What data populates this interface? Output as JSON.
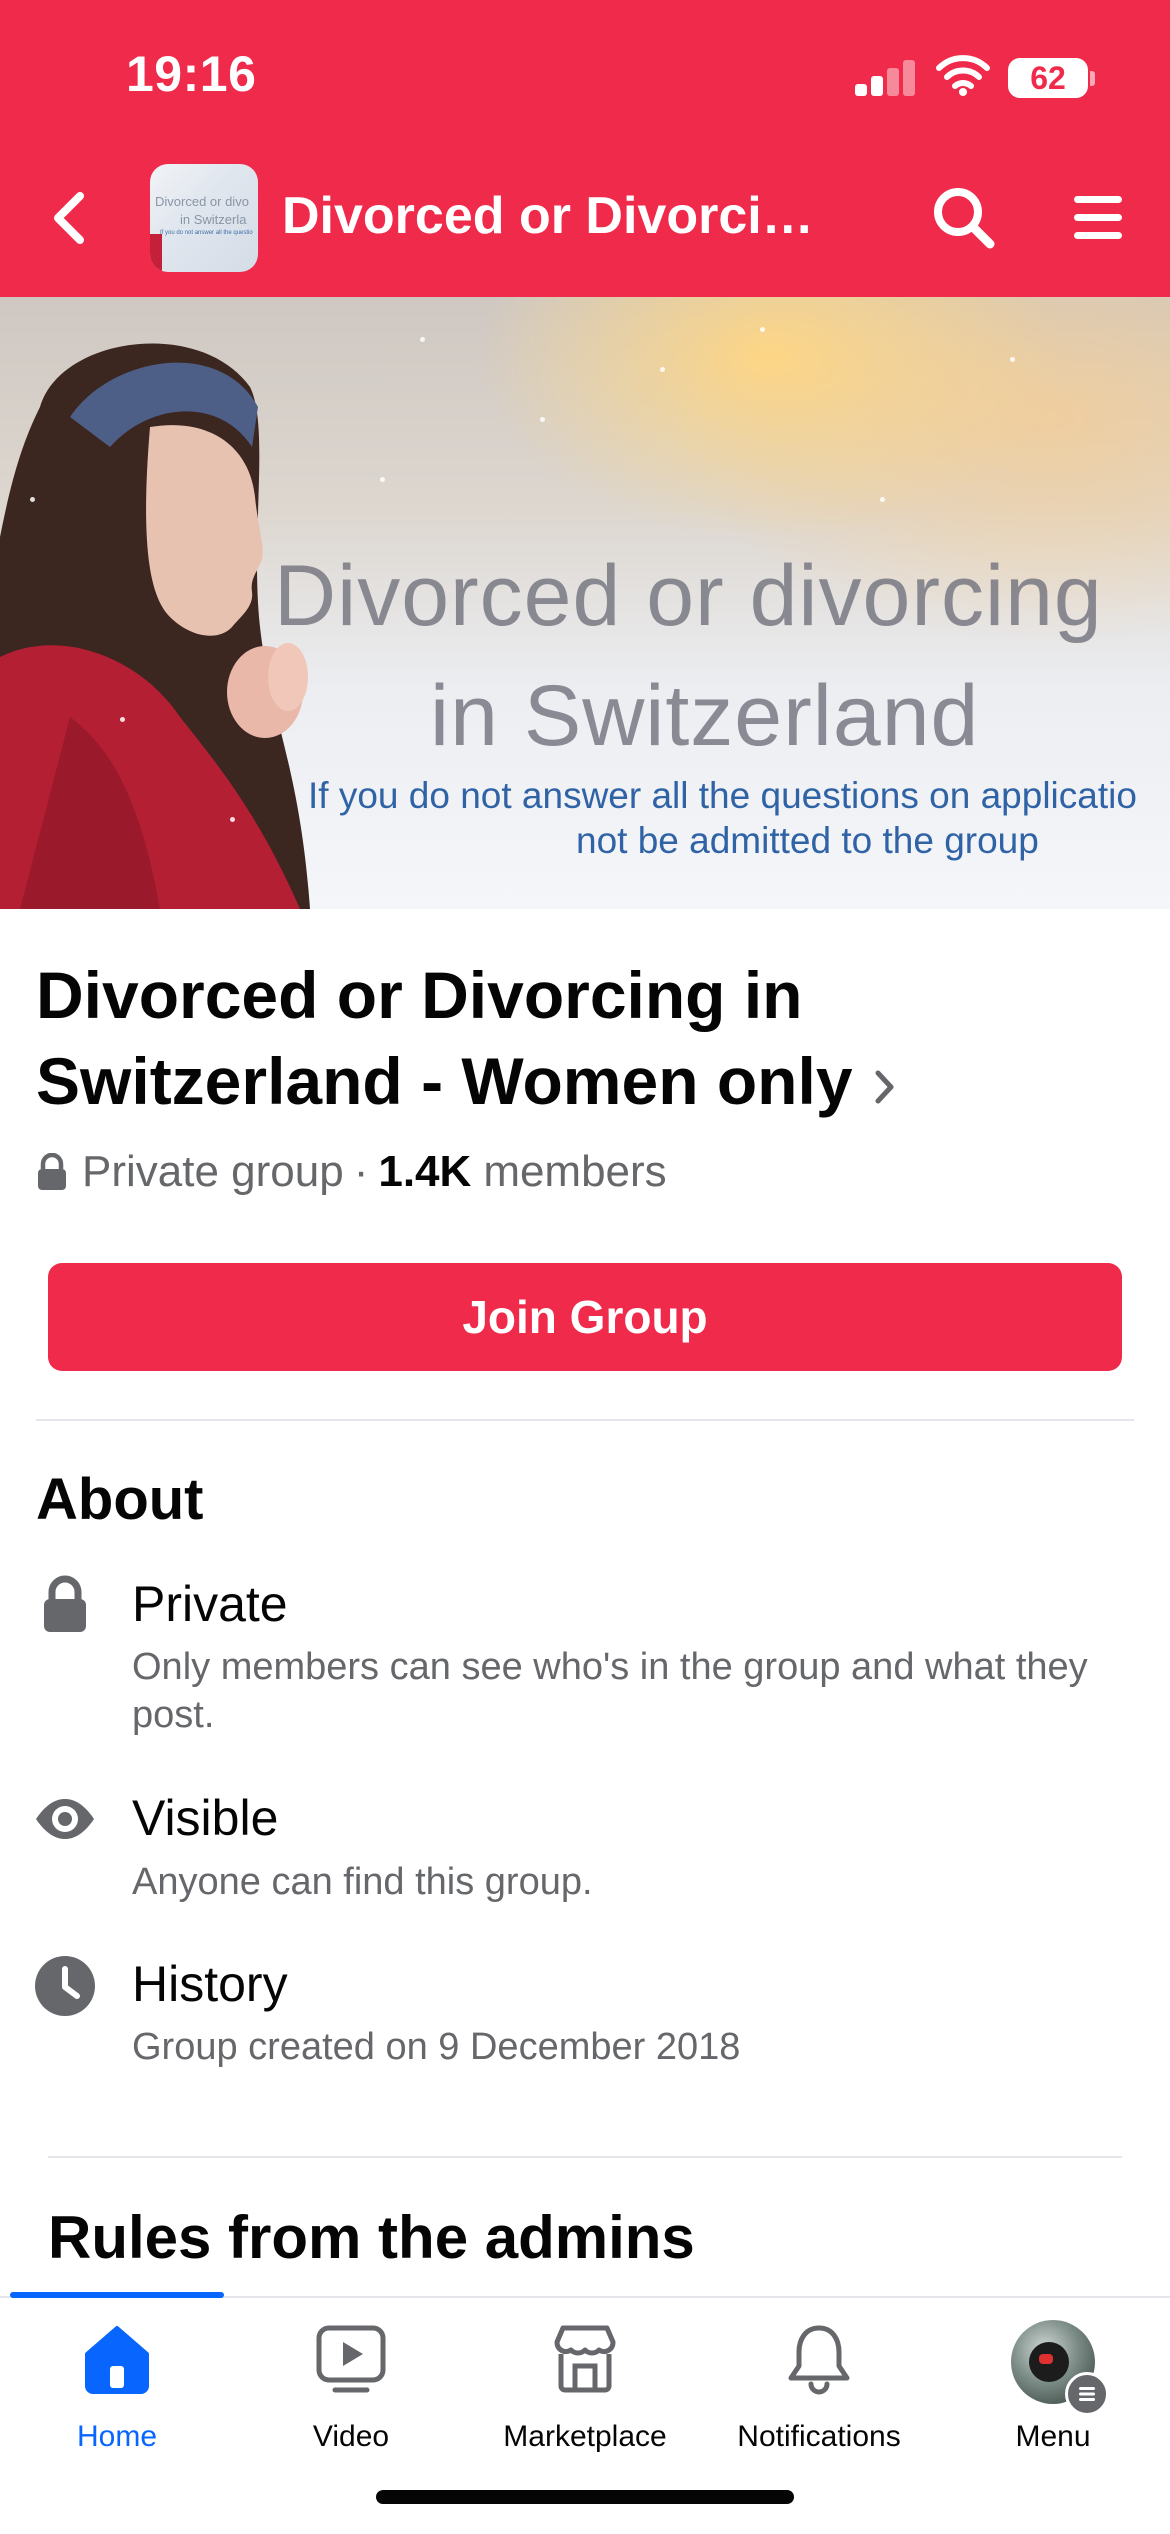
{
  "status_bar": {
    "time": "19:16",
    "battery": "62"
  },
  "header": {
    "title": "Divorced or Divorcing...",
    "thumbnail_text": {
      "line1": "Divorced or divo",
      "line2": "in Switzerla",
      "line3": "If you do not answer all the questio"
    },
    "back_icon": "chevron-left",
    "search_icon": "search",
    "menu_icon": "hamburger"
  },
  "cover": {
    "title_line1": "Divorced or divorcing",
    "title_line2": "in Switzerland",
    "note_line1": "If you do not answer all the questions on applicatio",
    "note_line2": "not be admitted to the group"
  },
  "group": {
    "name": "Divorced or Divorcing in Switzerland - Women only",
    "privacy": "Private group",
    "separator": "·",
    "member_count": "1.4K",
    "members_label": "members",
    "join_label": "Join Group"
  },
  "about": {
    "heading": "About",
    "items": [
      {
        "icon": "lock-icon",
        "title": "Private",
        "description": "Only members can see who's in the group and what they post."
      },
      {
        "icon": "eye-icon",
        "title": "Visible",
        "description": "Anyone can find this group."
      },
      {
        "icon": "clock-icon",
        "title": "History",
        "description": "Group created on 9 December 2018"
      }
    ]
  },
  "rules": {
    "heading": "Rules from the admins"
  },
  "bottom_nav": {
    "items": [
      {
        "label": "Home",
        "icon": "home-icon",
        "active": true
      },
      {
        "label": "Video",
        "icon": "video-icon",
        "active": false
      },
      {
        "label": "Marketplace",
        "icon": "marketplace-icon",
        "active": false
      },
      {
        "label": "Notifications",
        "icon": "bell-icon",
        "active": false
      },
      {
        "label": "Menu",
        "icon": "avatar",
        "active": false
      }
    ]
  },
  "colors": {
    "brand": "#ef2a4a",
    "active_nav": "#0866ff",
    "secondary_text": "#65676b"
  }
}
